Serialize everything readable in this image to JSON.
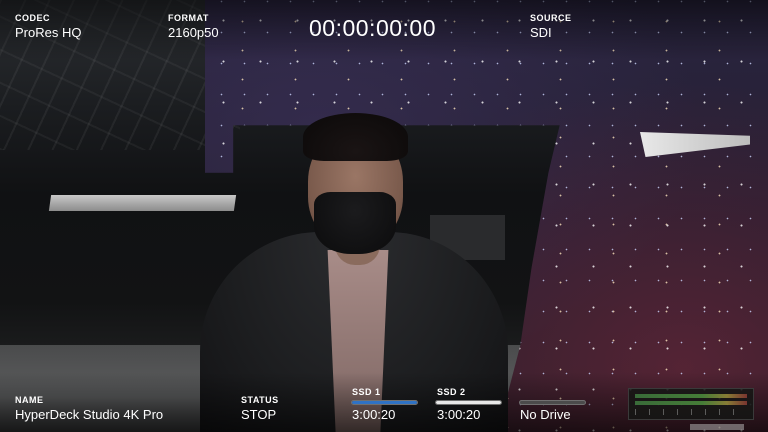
{
  "top_bar": {
    "codec": {
      "label": "CODEC",
      "value": "ProRes HQ"
    },
    "format": {
      "label": "FORMAT",
      "value": "2160p50"
    },
    "timecode": "00:00:00:00",
    "source": {
      "label": "SOURCE",
      "value": "SDI"
    }
  },
  "bottom_bar": {
    "name": {
      "label": "NAME",
      "value": "HyperDeck Studio 4K Pro"
    },
    "status": {
      "label": "STATUS",
      "value": "STOP"
    },
    "drives": [
      {
        "label": "SSD 1",
        "value": "3:00:20",
        "fill_fraction": 1.0,
        "fill_color": "#2f72c4"
      },
      {
        "label": "SSD 2",
        "value": "3:00:20",
        "fill_fraction": 1.0,
        "fill_color": "#e8e8e8"
      },
      {
        "label": "",
        "value": "No Drive",
        "fill_fraction": 0.0,
        "fill_color": "#5a5a5a"
      }
    ]
  },
  "audio_meter": {
    "icon": "audio-meter-icon"
  }
}
